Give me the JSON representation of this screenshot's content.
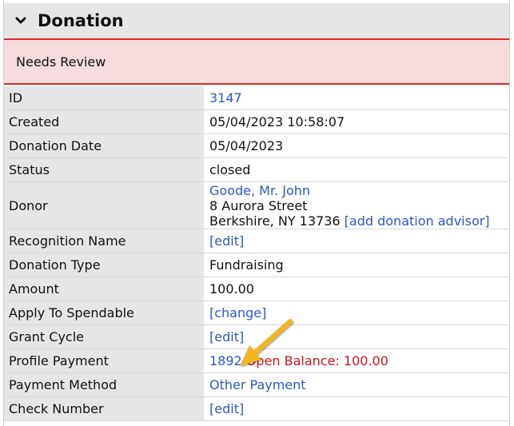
{
  "header": {
    "title": "Donation",
    "toggle_icon": "chevron-down-icon"
  },
  "alert": {
    "text": "Needs Review"
  },
  "fields": {
    "id": {
      "label": "ID",
      "value": "3147"
    },
    "created": {
      "label": "Created",
      "value": "05/04/2023 10:58:07"
    },
    "donation_date": {
      "label": "Donation Date",
      "value": "05/04/2023"
    },
    "status": {
      "label": "Status",
      "value": "closed"
    },
    "donor": {
      "label": "Donor",
      "name": "Goode, Mr. John",
      "street": "8 Aurora Street",
      "city": "Berkshire, NY 13736",
      "advisor_link": "[add donation advisor]"
    },
    "recognition_name": {
      "label": "Recognition Name",
      "value": "[edit]"
    },
    "donation_type": {
      "label": "Donation Type",
      "value": "Fundraising"
    },
    "amount": {
      "label": "Amount",
      "value": "100.00"
    },
    "apply_to_spendable": {
      "label": "Apply To Spendable",
      "value": "[change]"
    },
    "grant_cycle": {
      "label": "Grant Cycle",
      "value": "[edit]"
    },
    "profile_payment": {
      "label": "Profile Payment",
      "value": "1892",
      "balance": "Open Balance: 100.00"
    },
    "payment_method": {
      "label": "Payment Method",
      "value": "Other Payment"
    },
    "check_number": {
      "label": "Check Number",
      "value": "[edit]"
    }
  },
  "colors": {
    "link": "#2e56c9",
    "accent_red": "#d42a2a",
    "annotation_arrow": "#f2b51f"
  }
}
